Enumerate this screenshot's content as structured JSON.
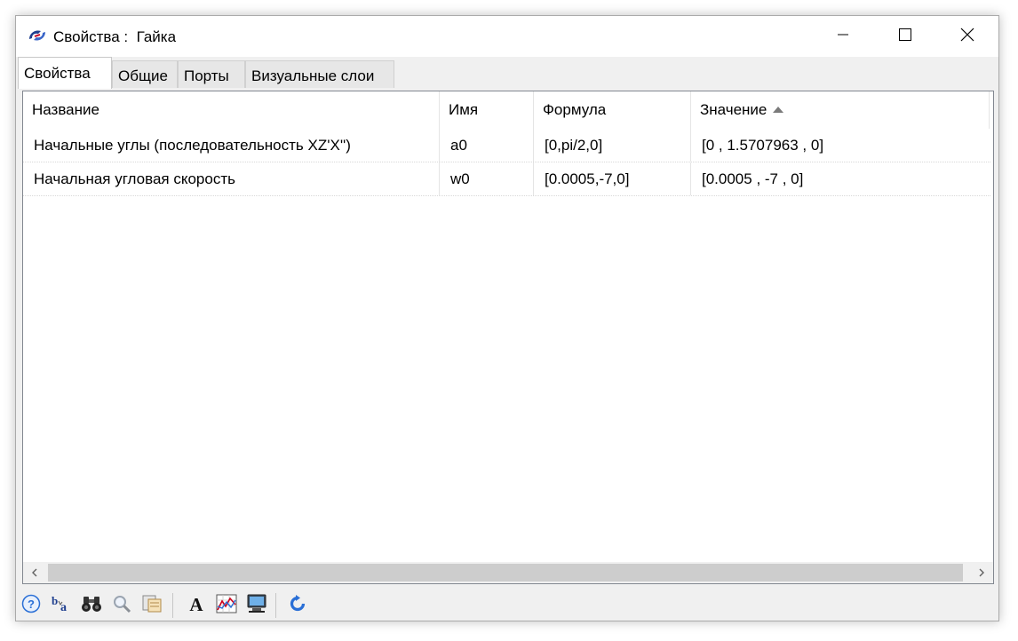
{
  "window": {
    "title_prefix": "Свойства :",
    "title_object": "Гайка"
  },
  "tabs": [
    {
      "label": "Свойства",
      "active": true
    },
    {
      "label": "Общие",
      "active": false
    },
    {
      "label": "Порты",
      "active": false
    },
    {
      "label": "Визуальные слои",
      "active": false
    }
  ],
  "table": {
    "columns": [
      "Название",
      "Имя",
      "Формула",
      "Значение"
    ],
    "sorted_column": "Значение",
    "sort_direction": "ascending",
    "rows": [
      [
        "Начальные углы (последовательность XZ'X'')",
        "a0",
        "[0,pi/2,0]",
        "[0 , 1.5707963 , 0]"
      ],
      [
        "Начальная угловая скорость",
        "w0",
        "[0.0005,-7,0]",
        "[0.0005 , -7 , 0]"
      ]
    ]
  },
  "toolbar": {
    "buttons": [
      "help-icon",
      "rename-icon",
      "binoculars-icon",
      "magnifier-icon",
      "settings-icon",
      "font-icon",
      "chart-icon",
      "monitor-icon",
      "refresh-icon"
    ]
  },
  "colors": {
    "window_bg": "#f0f0f0",
    "content_bg": "#ffffff",
    "accent_blue": "#2a6fd6"
  }
}
